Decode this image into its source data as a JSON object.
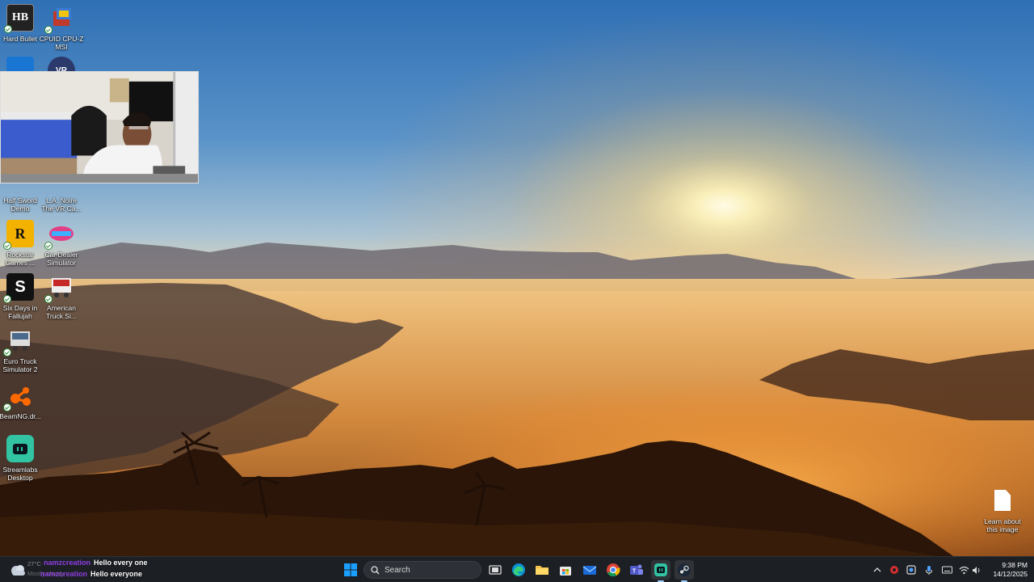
{
  "desktop": {
    "icons": [
      {
        "label_1": "Hard Bullet",
        "label_2": ""
      },
      {
        "label_1": "CPUID CPU-Z",
        "label_2": "MSI"
      },
      {
        "label_1": "Half Sword",
        "label_2": "Demo"
      },
      {
        "label_1": "L.A. Noire",
        "label_2": "The VR Ca..."
      },
      {
        "label_1": "Rockstar",
        "label_2": "Games ..."
      },
      {
        "label_1": "Car Dealer",
        "label_2": "Simulator"
      },
      {
        "label_1": "Six Days in",
        "label_2": "Fallujah"
      },
      {
        "label_1": "American",
        "label_2": "Truck Si..."
      },
      {
        "label_1": "Euro Truck",
        "label_2": "Simulator 2"
      },
      {
        "label_1": "BeamNG.dr...",
        "label_2": ""
      },
      {
        "label_1": "Streamlabs",
        "label_2": "Desktop"
      }
    ],
    "learn_label_1": "Learn about",
    "learn_label_2": "this image"
  },
  "chat": [
    {
      "user": "namzcreation",
      "message": "Hello every one"
    },
    {
      "user": "namzcreation",
      "message": "Hello everyone"
    }
  ],
  "weather": {
    "temp": "27°C",
    "condition": "Mostly cloudy"
  },
  "taskbar": {
    "search_placeholder": "Search",
    "time": "9:38 PM",
    "date": "14/12/2025",
    "apps": [
      "start",
      "search",
      "task-view",
      "edge",
      "file-explorer",
      "microsoft-store",
      "mail",
      "chrome",
      "teams",
      "streamlabs",
      "steam"
    ]
  },
  "colors": {
    "taskbar_bg": "#1c1f24",
    "chat_user": "#8e3fe0",
    "win_blue": "#0078d4"
  }
}
